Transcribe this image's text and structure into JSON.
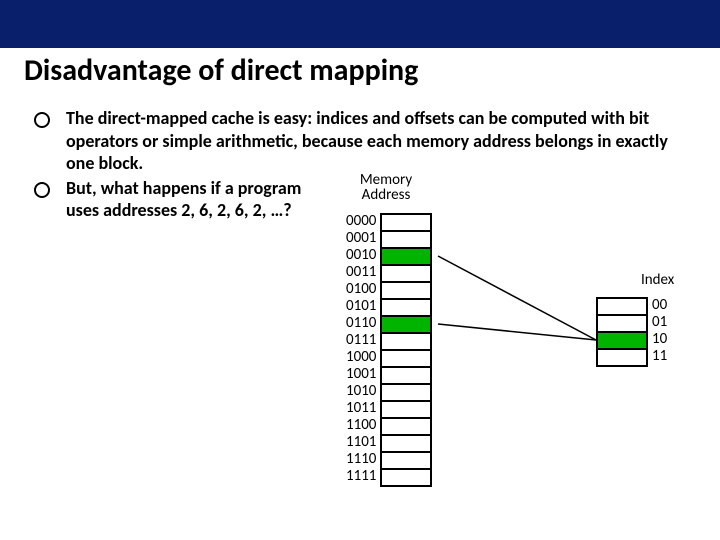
{
  "title": "Disadvantage of direct mapping",
  "bullets": [
    "The direct-mapped cache is easy: indices and offsets can be computed with bit operators or simple arithmetic, because each memory address belongs in exactly one block.",
    "But, what happens if a program uses addresses 2, 6, 2, 6, 2, …?"
  ],
  "mem_label_1": "Memory",
  "mem_label_2": "Address",
  "mem_addrs": [
    "0000",
    "0001",
    "0010",
    "0011",
    "0100",
    "0101",
    "0110",
    "0111",
    "1000",
    "1001",
    "1010",
    "1011",
    "1100",
    "1101",
    "1110",
    "1111"
  ],
  "mem_highlight": [
    2,
    6
  ],
  "idx_label": "Index",
  "cache_idx": [
    "00",
    "01",
    "10",
    "11"
  ],
  "cache_highlight": [
    2
  ]
}
